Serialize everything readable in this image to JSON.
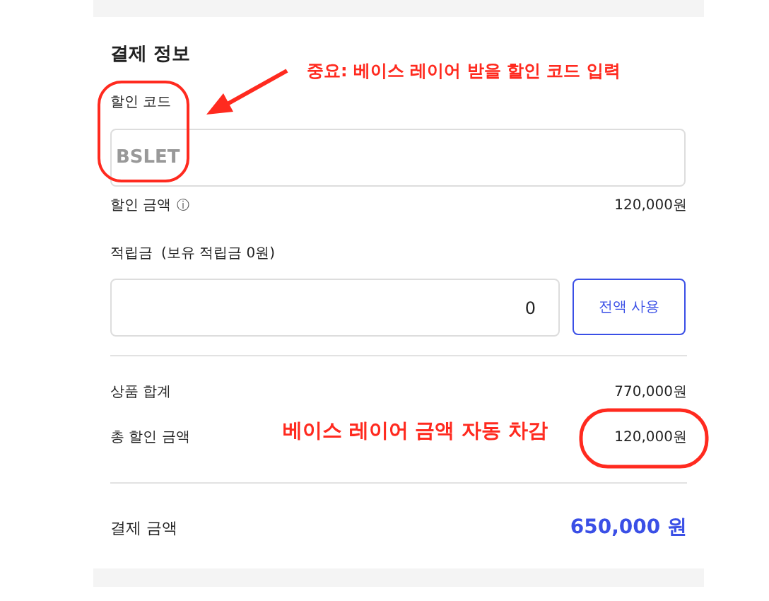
{
  "section_title": "결제 정보",
  "discount_code": {
    "label": "할인 코드",
    "placeholder": "BSLET"
  },
  "discount_amount": {
    "label": "할인 금액",
    "info_icon": "ⓘ",
    "value": "120,000원"
  },
  "points": {
    "label": "적립금",
    "balance": "(보유 적립금 0원)",
    "value": "0",
    "button": "전액 사용"
  },
  "summary": [
    {
      "label": "상품 합계",
      "value": "770,000원"
    },
    {
      "label": "총 할인 금액",
      "value": "120,000원"
    }
  ],
  "total": {
    "label": "결제 금액",
    "value": "650,000 원"
  },
  "annotations": [
    "중요: 베이스 레이어 받을 할인 코드 입력",
    "베이스 레이어 금액 자동 차감"
  ]
}
